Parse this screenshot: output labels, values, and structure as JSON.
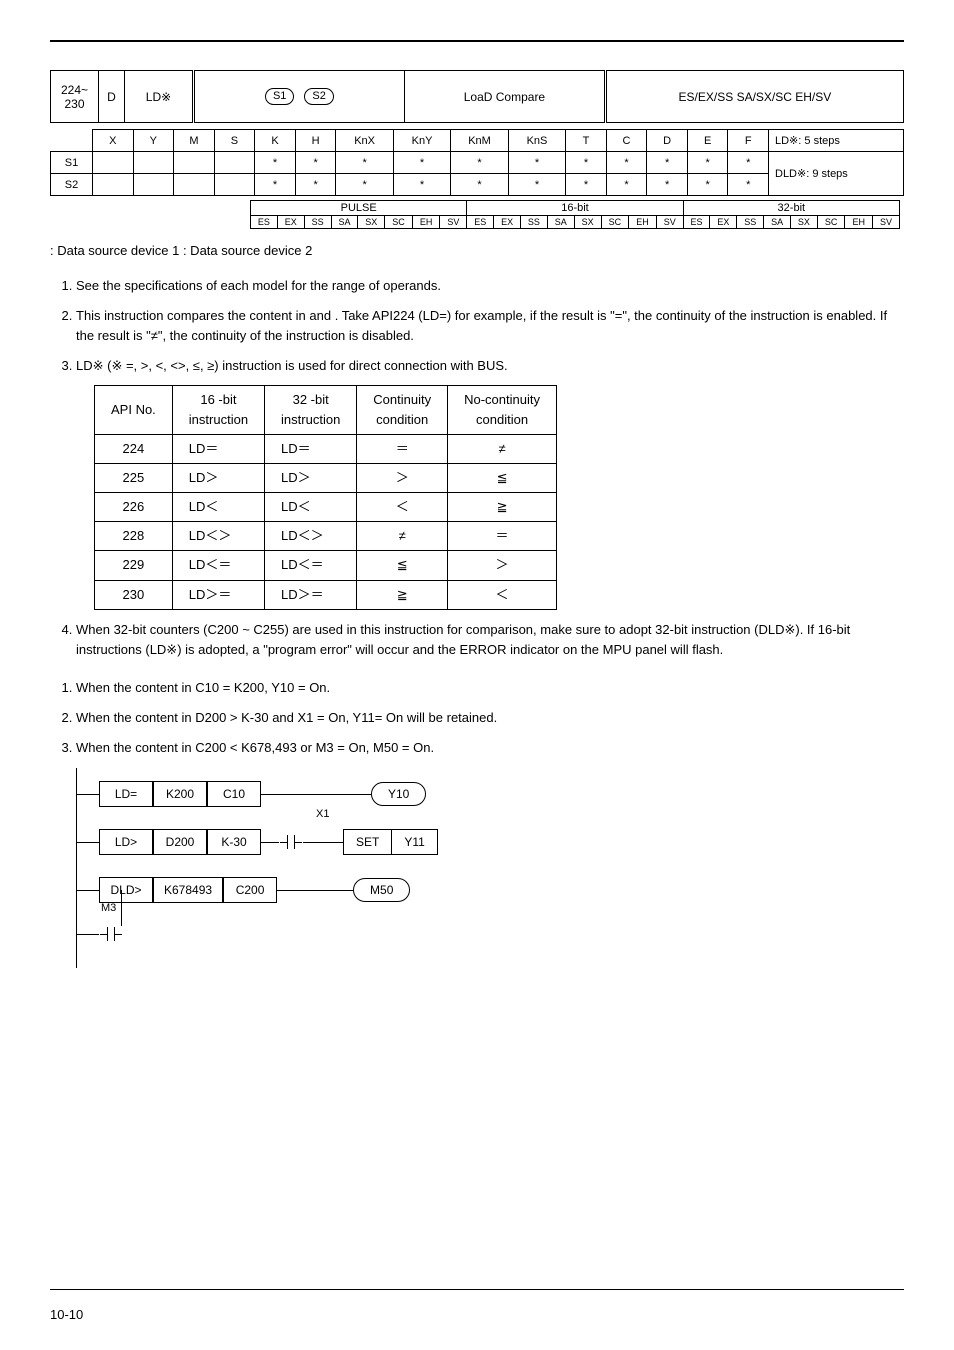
{
  "header": {
    "api_range": "224~\n230",
    "d": "D",
    "ld": "LD※",
    "s1": "S1",
    "s2": "S2",
    "load": "LoaD Compare",
    "models": "ES/EX/SS SA/SX/SC EH/SV",
    "cols": [
      "X",
      "Y",
      "M",
      "S",
      "K",
      "H",
      "KnX",
      "KnY",
      "KnM",
      "KnS",
      "T",
      "C",
      "D",
      "E",
      "F"
    ],
    "row_labels": [
      "S1",
      "S2"
    ],
    "steps1": "LD※: 5 steps",
    "steps2": "DLD※: 9 steps",
    "pulse_header": [
      "PULSE",
      "16-bit",
      "32-bit"
    ],
    "tiny": [
      "ES",
      "EX",
      "SS",
      "SA",
      "SX",
      "SC",
      "EH",
      "SV",
      "ES",
      "EX",
      "SS",
      "SA",
      "SX",
      "SC",
      "EH",
      "SV",
      "ES",
      "EX",
      "SS",
      "SA",
      "SX",
      "SC",
      "EH",
      "SV"
    ]
  },
  "src_line": ": Data source device 1        : Data source device 2",
  "points1": {
    "p1": "See the specifications of each model for the range of operands.",
    "p2a": "This instruction compares the content in ",
    "p2b": " and ",
    "p2c": " . Take API224 (LD=) for example, if the result is \"=\", the continuity of the instruction is enabled. If the result is \"≠\", the continuity of the instruction is disabled.",
    "p3": "LD※ (※ =, >, <, <>, ≤, ≥) instruction is used for direct connection with BUS.",
    "p4": "When 32-bit counters (C200 ~ C255) are used in this instruction for comparison, make sure to adopt 32-bit instruction (DLD※). If 16-bit instructions (LD※) is adopted, a \"program error\" will occur and the ERROR indicator on the MPU panel will flash."
  },
  "api_table": {
    "headers": [
      "API No.",
      "16 -bit\ninstruction",
      "32 -bit\ninstruction",
      "Continuity\ncondition",
      "No-continuity\ncondition"
    ],
    "rows": [
      [
        "224",
        "LD＝",
        "LD＝",
        "＝",
        "≠"
      ],
      [
        "225",
        "LD＞",
        "LD＞",
        "＞",
        "≦"
      ],
      [
        "226",
        "LD＜",
        "LD＜",
        "＜",
        "≧"
      ],
      [
        "228",
        "LD＜＞",
        "LD＜＞",
        "≠",
        "＝"
      ],
      [
        "229",
        "LD＜＝",
        "LD＜＝",
        "≦",
        "＞"
      ],
      [
        "230",
        "LD＞＝",
        "LD＞＝",
        "≧",
        "＜"
      ]
    ]
  },
  "points2": {
    "p1": "When the content in C10 = K200, Y10 = On.",
    "p2": "When the content in D200 > K-30 and X1 = On, Y11= On will be retained.",
    "p3": "When the content in C200 < K678,493 or M3 = On, M50 = On."
  },
  "ladder": {
    "r1": {
      "a": "LD=",
      "b": "K200",
      "c": "C10",
      "out": "Y10"
    },
    "r2": {
      "a": "LD>",
      "b": "D200",
      "c": "K-30",
      "x": "X1",
      "set": "SET",
      "out": "Y11"
    },
    "r3": {
      "a": "DLD>",
      "b": "K678493",
      "c": "C200",
      "out": "M50"
    },
    "m3": "M3"
  },
  "footer": "10-10"
}
